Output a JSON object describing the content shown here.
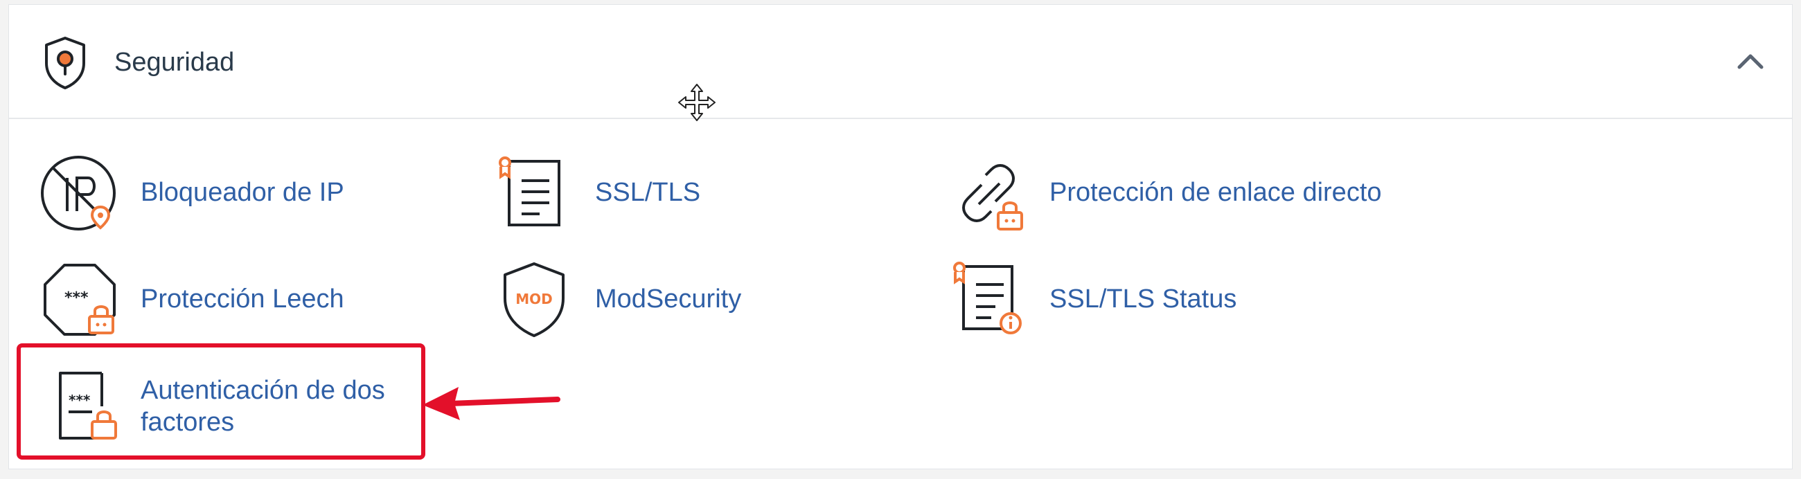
{
  "section": {
    "title": "Seguridad",
    "header_icon": "shield-pin-icon",
    "collapse_icon": "chevron-up-icon"
  },
  "items": [
    {
      "label": "Bloqueador de IP",
      "icon": "ip-blocker-icon"
    },
    {
      "label": "SSL/TLS",
      "icon": "ssl-certificate-icon"
    },
    {
      "label": "Protección de enlace directo",
      "icon": "hotlink-protection-icon"
    },
    {
      "label": "Protección Leech",
      "icon": "leech-protection-icon"
    },
    {
      "label": "ModSecurity",
      "icon": "modsecurity-shield-icon"
    },
    {
      "label": "SSL/TLS Status",
      "icon": "ssl-status-icon"
    },
    {
      "label_line1": "Autenticación de dos",
      "label_line2": "factores",
      "icon": "two-factor-auth-icon"
    }
  ],
  "annotation": {
    "highlight_color": "#e3102a"
  },
  "colors": {
    "link": "#2f5fa6",
    "title": "#293a4a",
    "accent": "#f0793a",
    "icon_stroke": "#1f2328"
  }
}
